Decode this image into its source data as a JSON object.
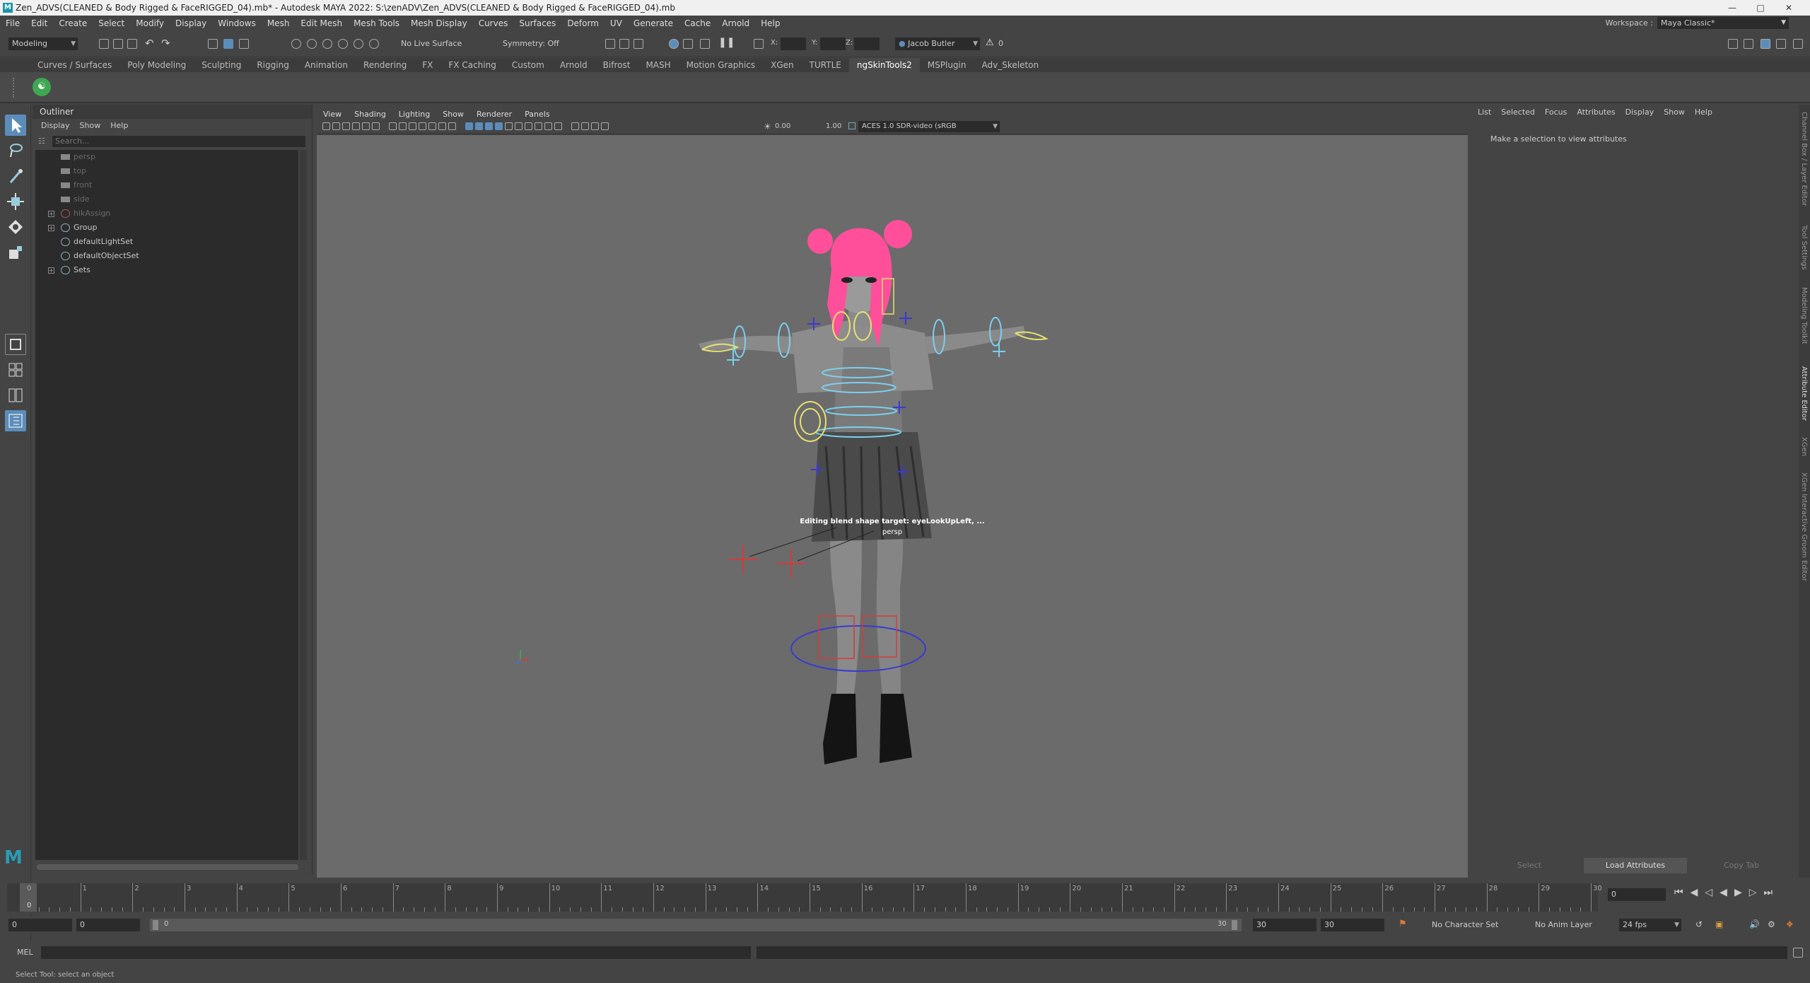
{
  "window": {
    "title": "Zen_ADVS(CLEANED & Body Rigged & FaceRIGGED_04).mb* - Autodesk MAYA 2022: S:\\zenADV\\Zen_ADVS(CLEANED & Body Rigged & FaceRIGGED_04).mb"
  },
  "menubar": {
    "items": [
      "File",
      "Edit",
      "Create",
      "Select",
      "Modify",
      "Display",
      "Windows",
      "Mesh",
      "Edit Mesh",
      "Mesh Tools",
      "Mesh Display",
      "Curves",
      "Surfaces",
      "Deform",
      "UV",
      "Generate",
      "Cache",
      "Arnold",
      "Help"
    ],
    "workspace_label": "Workspace :",
    "workspace_value": "Maya Classic*"
  },
  "statusline": {
    "mode": "Modeling",
    "live_surface": "No Live Surface",
    "symmetry": "Symmetry: Off",
    "x_label": "X:",
    "y_label": "Y:",
    "z_label": "Z:",
    "user": "Jacob Butler",
    "warnings": "0"
  },
  "shelf": {
    "tabs": [
      "Curves / Surfaces",
      "Poly Modeling",
      "Sculpting",
      "Rigging",
      "Animation",
      "Rendering",
      "FX",
      "FX Caching",
      "Custom",
      "Arnold",
      "Bifrost",
      "MASH",
      "Motion Graphics",
      "XGen",
      "TURTLE",
      "ngSkinTools2",
      "MSPlugin",
      "Adv_Skeleton"
    ],
    "active_tab": "ngSkinTools2"
  },
  "outliner": {
    "title": "Outliner",
    "menu": [
      "Display",
      "Show",
      "Help"
    ],
    "search_placeholder": "Search...",
    "items": [
      {
        "label": "persp",
        "dim": true,
        "expand": false,
        "icon": "camera"
      },
      {
        "label": "top",
        "dim": true,
        "expand": false,
        "icon": "camera"
      },
      {
        "label": "front",
        "dim": true,
        "expand": false,
        "icon": "camera"
      },
      {
        "label": "side",
        "dim": true,
        "expand": false,
        "icon": "camera"
      },
      {
        "label": "hikAssign",
        "dim": true,
        "expand": true,
        "icon": "node"
      },
      {
        "label": "Group",
        "dim": false,
        "expand": true,
        "icon": "group"
      },
      {
        "label": "defaultLightSet",
        "dim": false,
        "expand": false,
        "icon": "set"
      },
      {
        "label": "defaultObjectSet",
        "dim": false,
        "expand": false,
        "icon": "set"
      },
      {
        "label": "Sets",
        "dim": false,
        "expand": true,
        "icon": "set"
      }
    ]
  },
  "viewport": {
    "menu": [
      "View",
      "Shading",
      "Lighting",
      "Show",
      "Renderer",
      "Panels"
    ],
    "exposure": "0.00",
    "gamma": "1.00",
    "color_space": "ACES 1.0 SDR-video (sRGB",
    "hud_message": "Editing blend shape target: eyeLookUpLeft, ...",
    "camera_label": "persp"
  },
  "attribute_editor": {
    "menu": [
      "List",
      "Selected",
      "Focus",
      "Attributes",
      "Display",
      "Show",
      "Help"
    ],
    "message": "Make a selection to view attributes",
    "buttons": {
      "select": "Select",
      "load": "Load Attributes",
      "copy": "Copy Tab"
    }
  },
  "side_tabs": [
    "Channel Box / Layer Editor",
    "Tool Settings",
    "Modeling Toolkit",
    "Attribute Editor",
    "XGen",
    "XGen Interactive Groom Editor"
  ],
  "timeline": {
    "ticks": [
      "1",
      "2",
      "3",
      "4",
      "5",
      "6",
      "7",
      "8",
      "9",
      "10",
      "11",
      "12",
      "13",
      "14",
      "15",
      "16",
      "17",
      "18",
      "19",
      "20",
      "21",
      "22",
      "23",
      "24",
      "25",
      "26",
      "27",
      "28",
      "29",
      "30"
    ],
    "start_tick": "0",
    "current_frame": "0",
    "current_frame_field": "0"
  },
  "range": {
    "start": "0",
    "playback_start": "0",
    "slider_start": "0",
    "slider_end": "30",
    "playback_end": "30",
    "end": "30",
    "character_set": "No Character Set",
    "anim_layer": "No Anim Layer",
    "fps": "24 fps"
  },
  "command_line": {
    "language": "MEL"
  },
  "help_line": {
    "text": "Select Tool: select an object"
  },
  "colors": {
    "accent": "#5c8dba",
    "viewport_bg": "#6b6b6b",
    "hair": "#ff4f9a",
    "control_cyan": "#7ad0ee",
    "control_yellow": "#e8e070",
    "locator_red": "#d83a3a",
    "locator_blue": "#3a3ad0"
  }
}
